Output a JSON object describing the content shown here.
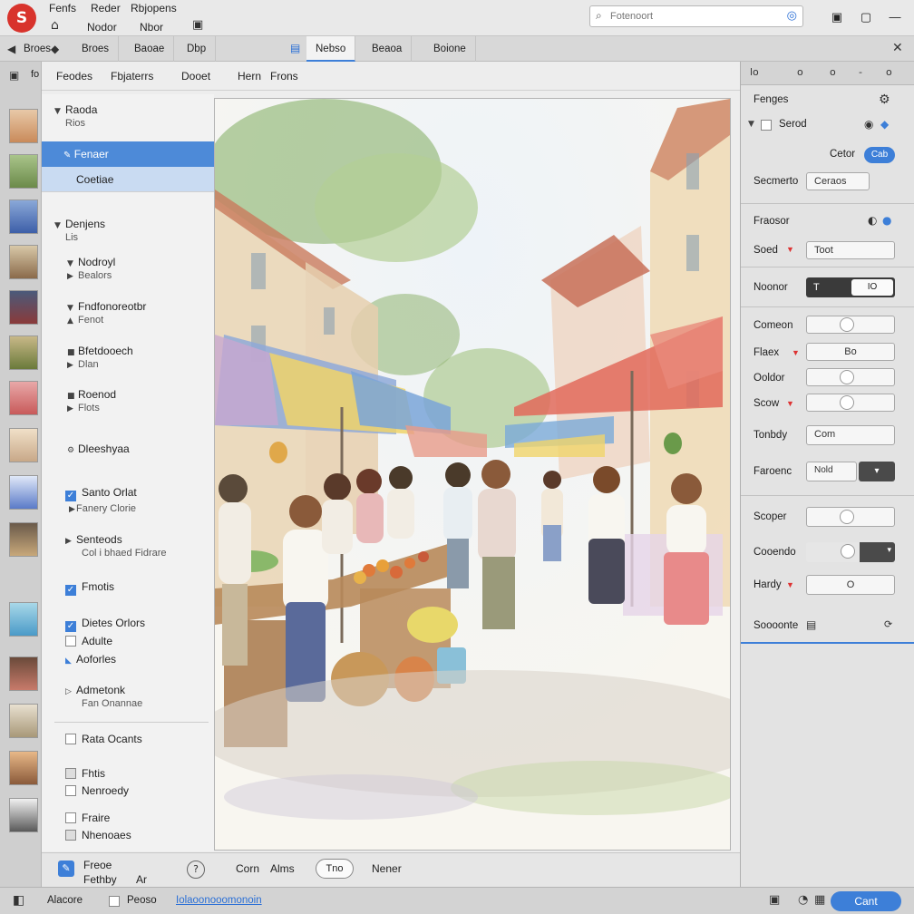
{
  "app": {
    "menu": [
      "Fenfs",
      "Reder",
      "Rbjopens"
    ],
    "menu2": [
      "Nodor",
      "Nbor"
    ],
    "search_placeholder": "Fotenoort"
  },
  "tabs": [
    "Broes",
    "Baoae",
    "Dbp",
    "Nebso",
    "Beaoa",
    "Boione"
  ],
  "subtabs": [
    "Feodes",
    "Fbjaterrs",
    "Dooet",
    "Hern",
    "Frons"
  ],
  "tree": {
    "section1": {
      "title": "Raoda",
      "sub": "Rios"
    },
    "selected": "Fenaer",
    "selected_sub": "Coetiae",
    "section2": {
      "title": "Denjens",
      "sub": "Lis"
    },
    "items": [
      {
        "title": "Nodroyl",
        "sub": "Bealors"
      },
      {
        "title": "Fndfonoreotbr",
        "sub": "Fenot"
      },
      {
        "title": "Bfetdooech",
        "sub": "Dlan"
      },
      {
        "title": "Roenod",
        "sub": "Flots"
      },
      {
        "title": "Dleeshyaa"
      }
    ],
    "checks": [
      {
        "title": "Santo Orlat",
        "sub": "Fanery Clorie",
        "checked": true
      },
      {
        "title": "Senteods",
        "sub": "Col i bhaed Fidrare"
      },
      {
        "title": "Fmotis",
        "checked": true
      },
      {
        "title": "Dietes Orlors",
        "checked": true
      },
      {
        "title": "Adulte",
        "checked": false
      },
      {
        "title": "Aoforles",
        "checked": false
      },
      {
        "title": "Admetonk",
        "sub": "Fan Onannae"
      },
      {
        "title": "Rata Ocants",
        "checked": false
      },
      {
        "title": "Fhtis",
        "checked": false
      },
      {
        "title": "Nenroedy",
        "checked": false
      },
      {
        "title": "Fraire",
        "checked": false
      },
      {
        "title": "Nhenoaes",
        "checked": false
      }
    ]
  },
  "bottom": {
    "label1": "Freoe",
    "label1b": "Fethby",
    "label1c": "Ar",
    "label2": "Corn",
    "label3": "Alms",
    "pill": "Tno",
    "label4": "Nener"
  },
  "right": {
    "tabs": [
      "lo",
      "o",
      "o",
      "-",
      "o"
    ],
    "section1": "Fenges",
    "row1": "Serod",
    "row2": "Cetor",
    "row2_val": "Cab",
    "segment_label": "Secmerto",
    "segment_val": "Ceraos",
    "section2": "Fraosor",
    "sead_label": "Soed",
    "sead_val": "Toot",
    "neonor_label": "Noonor",
    "neonor_val1": "T",
    "neonor_val2": "IO",
    "toggles": [
      {
        "label": "Comeon",
        "value": ""
      },
      {
        "label": "Flaex",
        "value": "Bo"
      },
      {
        "label": "Ooldor",
        "value": ""
      },
      {
        "label": "Scow",
        "value": ""
      }
    ],
    "tonby_label": "Tonbdy",
    "tonby_val": "Com",
    "fance_label": "Faroenc",
    "fance_val": "Nold",
    "scoper_label": "Scoper",
    "cooerdo_label": "Cooendo",
    "hardy_label": "Hardy",
    "hardy_val": "O",
    "sooonte_label": "Soooonte"
  },
  "status": {
    "items": [
      "Alacore",
      "Peoso",
      "Iolaoonooomonoin"
    ],
    "button": "Cant"
  }
}
